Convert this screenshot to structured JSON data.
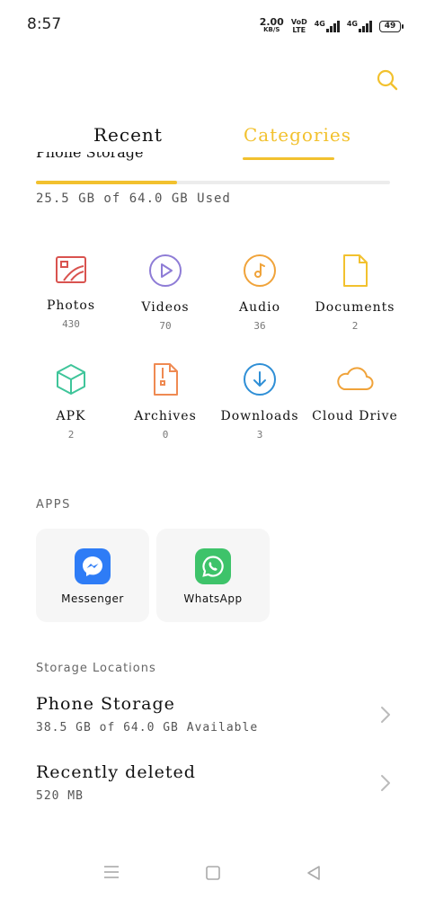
{
  "status_bar": {
    "time": "8:57",
    "speed_value": "2.00",
    "speed_unit": "KB/S",
    "volte_top": "VoD",
    "volte_bottom": "LTE",
    "network_1": "4G",
    "network_2": "4G",
    "battery": "49"
  },
  "header": {
    "search_icon": "search-icon"
  },
  "tabs": [
    {
      "label": "Recent",
      "active": false
    },
    {
      "label": "Categories",
      "active": true
    }
  ],
  "colors": {
    "accent": "#f2c12e",
    "photos": "#d9534f",
    "videos": "#8e7cd6",
    "audio": "#f0a33a",
    "documents": "#f2c12e",
    "apk": "#3fc59a",
    "archives": "#ef8a52",
    "downloads": "#2f8fd6",
    "cloud": "#f0a33a",
    "messenger": "#2e7cf6",
    "whatsapp": "#3ec36a"
  },
  "storage_summary": {
    "title": "Phone Storage",
    "used_text": "25.5 GB of 64.0 GB Used",
    "used_fraction": 0.398
  },
  "categories": [
    {
      "label": "Photos",
      "count": "430",
      "icon": "photos-icon"
    },
    {
      "label": "Videos",
      "count": "70",
      "icon": "videos-icon"
    },
    {
      "label": "Audio",
      "count": "36",
      "icon": "audio-icon"
    },
    {
      "label": "Documents",
      "count": "2",
      "icon": "documents-icon"
    },
    {
      "label": "APK",
      "count": "2",
      "icon": "apk-icon"
    },
    {
      "label": "Archives",
      "count": "0",
      "icon": "archives-icon"
    },
    {
      "label": "Downloads",
      "count": "3",
      "icon": "downloads-icon"
    },
    {
      "label": "Cloud Drive",
      "count": "",
      "icon": "cloud-drive-icon"
    }
  ],
  "apps": {
    "section_label": "APPS",
    "items": [
      {
        "label": "Messenger",
        "icon": "messenger-icon"
      },
      {
        "label": "WhatsApp",
        "icon": "whatsapp-icon"
      }
    ]
  },
  "storage_locations": {
    "section_label": "Storage Locations",
    "items": [
      {
        "title": "Phone Storage",
        "subtitle": "38.5 GB of 64.0 GB Available"
      },
      {
        "title": "Recently deleted",
        "subtitle": "520 MB"
      }
    ]
  },
  "nav": {
    "menu_icon": "menu-icon",
    "home_icon": "home-icon",
    "back_icon": "back-icon"
  }
}
